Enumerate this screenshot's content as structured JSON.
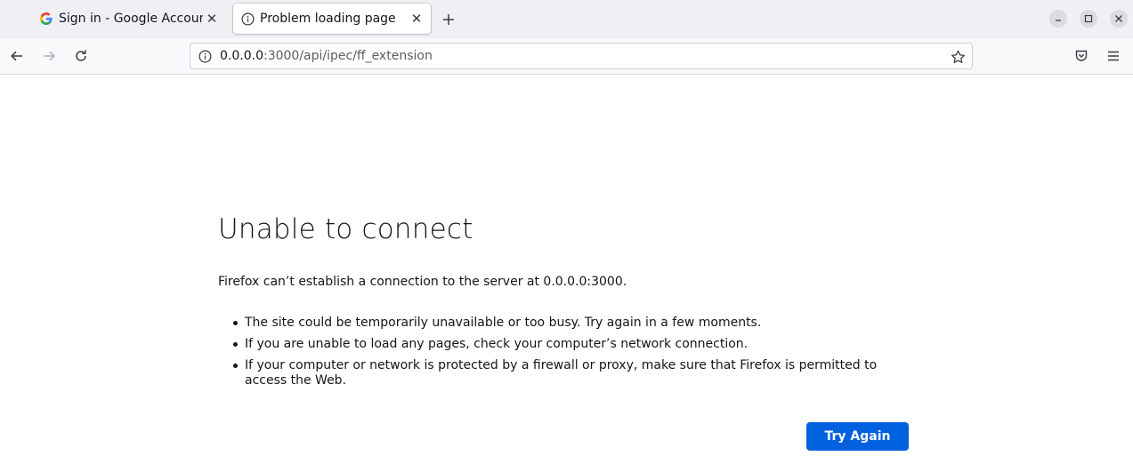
{
  "tabs": [
    {
      "title": "Sign in - Google Accounts",
      "favicon": "google-icon",
      "active": false
    },
    {
      "title": "Problem loading page",
      "favicon": "info-icon",
      "active": true
    }
  ],
  "urlbar": {
    "host": "0.0.0.0",
    "rest": ":3000/api/ipec/ff_extension"
  },
  "error": {
    "title": "Unable to connect",
    "description": "Firefox can’t establish a connection to the server at 0.0.0.0:3000.",
    "reasons": [
      "The site could be temporarily unavailable or too busy. Try again in a few moments.",
      "If you are unable to load any pages, check your computer’s network connection.",
      "If your computer or network is protected by a firewall or proxy, make sure that Firefox is permitted to access the Web."
    ],
    "try_again_label": "Try Again"
  },
  "colors": {
    "accent": "#0061e0",
    "tabstrip_bg": "#f0f0f4",
    "navbar_bg": "#f9f9fb"
  }
}
